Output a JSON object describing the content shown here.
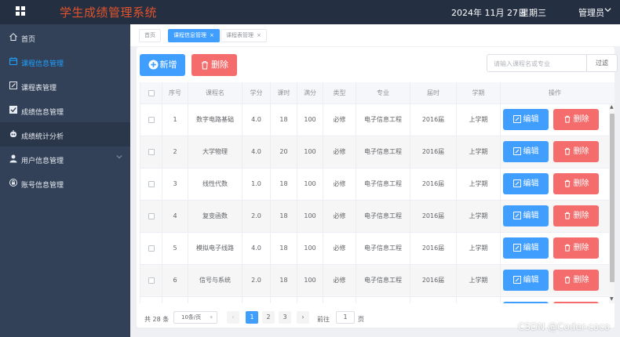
{
  "header": {
    "app_title": "学生成绩管理系统",
    "date": "2024年 11月 27日",
    "weekday": "星期三",
    "user": "管理员"
  },
  "sidebar": {
    "items": [
      {
        "label": "首页",
        "icon": "home-icon"
      },
      {
        "label": "课程信息管理",
        "icon": "calendar-icon"
      },
      {
        "label": "课程表管理",
        "icon": "edit-icon"
      },
      {
        "label": "成绩信息管理",
        "icon": "checkbox-icon"
      },
      {
        "label": "成绩统计分析",
        "icon": "bot-icon"
      },
      {
        "label": "用户信息管理",
        "icon": "user-icon"
      },
      {
        "label": "账号信息管理",
        "icon": "lock-icon"
      }
    ]
  },
  "tags": [
    {
      "label": "首页"
    },
    {
      "label": "课程信息管理",
      "close": "×"
    },
    {
      "label": "课程表管理",
      "close": "×"
    }
  ],
  "toolbar": {
    "add_label": "新增",
    "delete_label": "删除",
    "search_placeholder": "请输入课程名或专业",
    "filter_label": "过滤"
  },
  "table": {
    "columns": [
      "",
      "序号",
      "课程名",
      "学分",
      "课时",
      "满分",
      "类型",
      "专业",
      "届时",
      "学期",
      "操作"
    ],
    "rows": [
      {
        "id": "1",
        "name": "数字电路基础",
        "credit": "4.0",
        "hours": "18",
        "full": "100",
        "type": "必修",
        "major": "电子信息工程",
        "year": "2016届",
        "term": "上学期"
      },
      {
        "id": "2",
        "name": "大学物理",
        "credit": "4.0",
        "hours": "20",
        "full": "100",
        "type": "必修",
        "major": "电子信息工程",
        "year": "2016届",
        "term": "上学期"
      },
      {
        "id": "3",
        "name": "线性代数",
        "credit": "1.0",
        "hours": "18",
        "full": "100",
        "type": "必修",
        "major": "电子信息工程",
        "year": "2016届",
        "term": "上学期"
      },
      {
        "id": "4",
        "name": "复变函数",
        "credit": "2.0",
        "hours": "18",
        "full": "100",
        "type": "必修",
        "major": "电子信息工程",
        "year": "2016届",
        "term": "上学期"
      },
      {
        "id": "5",
        "name": "模拟电子线路",
        "credit": "4.0",
        "hours": "18",
        "full": "100",
        "type": "必修",
        "major": "电子信息工程",
        "year": "2016届",
        "term": "上学期"
      },
      {
        "id": "6",
        "name": "信号与系统",
        "credit": "2.0",
        "hours": "18",
        "full": "100",
        "type": "必修",
        "major": "电子信息工程",
        "year": "2016届",
        "term": "上学期"
      }
    ],
    "edit_label": "编辑",
    "delete_label": "删除"
  },
  "pagination": {
    "total": "共 28 条",
    "page_size": "10条/页",
    "prev": "‹",
    "pages": [
      "1",
      "2",
      "3"
    ],
    "next": "›",
    "goto_label": "前往",
    "goto_value": "1",
    "page_suffix": "页"
  },
  "watermark": "CSDN @Coder-coco",
  "colors": {
    "primary": "#409eff",
    "danger": "#f56c6c",
    "sidebar_bg": "#324157",
    "header_bg": "#242f42",
    "title_accent": "#e0532c"
  }
}
